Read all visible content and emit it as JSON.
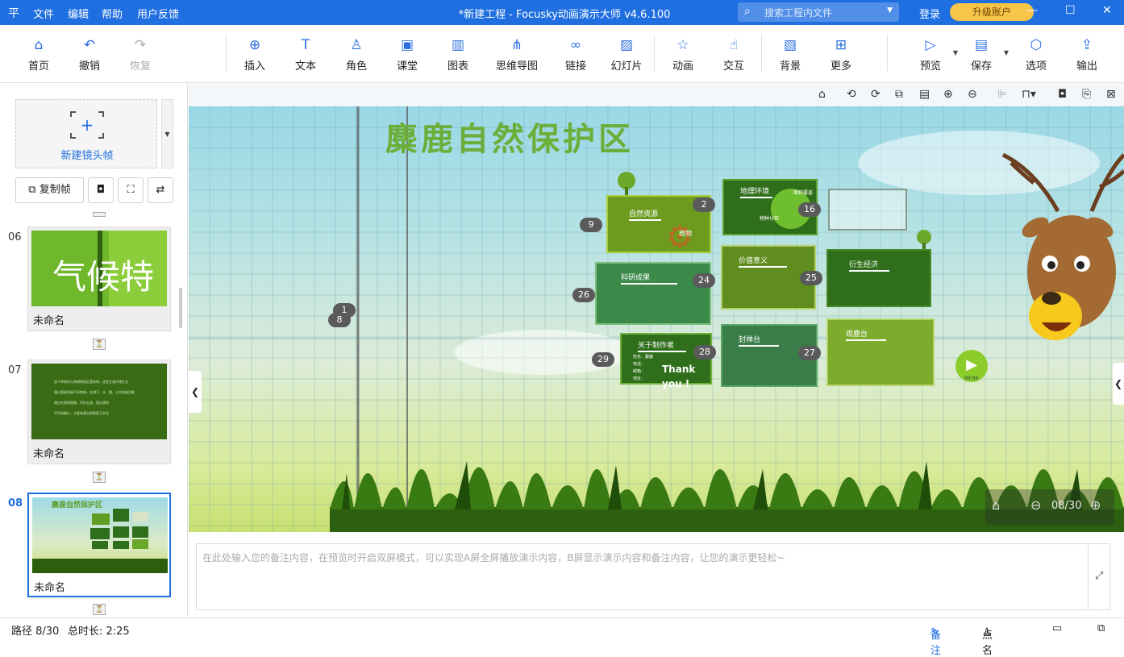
{
  "titlebar": {
    "logo": "平",
    "menu": [
      "文件",
      "编辑",
      "帮助",
      "用户反馈"
    ],
    "title": "*新建工程 - Focusky动画演示大师  v4.6.100",
    "search_placeholder": "搜索工程内文件",
    "login": "登录",
    "upgrade": "升级账户",
    "window_buttons": [
      "—",
      "☐",
      "✕"
    ]
  },
  "toolbar": {
    "home": "首页",
    "undo": "撤销",
    "redo": "恢复",
    "insert": "插入",
    "text": "文本",
    "role": "角色",
    "classroom": "课堂",
    "chart": "图表",
    "mindmap": "思维导图",
    "link": "链接",
    "slide": "幻灯片",
    "animation": "动画",
    "interact": "交互",
    "background": "背景",
    "more": "更多",
    "preview": "预览",
    "save": "保存",
    "options": "选项",
    "export": "输出"
  },
  "sidebar": {
    "new_frame": "新建镜头帧",
    "copy_frame": "复制帧",
    "slides": [
      {
        "number": "06",
        "name": "未命名",
        "thumb_text": "气候特"
      },
      {
        "number": "07",
        "name": "未命名",
        "thumb_lines": [
          "该干旱地机与海湖和地区宽地带，适宜生态环境生长",
          "通过限制发展干旱地带，在湖下、水、路、公共设施功能",
          "通过在营养植物，评估五成，而后规划",
          "早开始确认，主要来源自然景星习文化"
        ]
      },
      {
        "number": "08",
        "name": "未命名",
        "thumb_title": "麋鹿自然保护区"
      }
    ]
  },
  "stage": {
    "title": "麋鹿自然保护区",
    "boxes": {
      "natural": {
        "title": "自然资源",
        "sub": "植物"
      },
      "geo": {
        "title": "地理环境",
        "sub1": "面积覆盖",
        "sub2": "物种分布"
      },
      "science": {
        "title": "科研成果"
      },
      "value": {
        "title": "价值意义"
      },
      "derived": {
        "title": "衍生经济"
      },
      "author": {
        "title": "关于制作者",
        "rows": [
          "姓名：麋鹿",
          "电话：",
          "邮箱：",
          "地址："
        ]
      },
      "altar": {
        "title": "封禅台"
      },
      "viewdeck": {
        "title": "观鹿台"
      },
      "thank": "Thank you !"
    },
    "badges": [
      "2",
      "9",
      "16",
      "24",
      "25",
      "26",
      "27",
      "28",
      "29",
      "1",
      "8"
    ],
    "play_time": "00:00",
    "nav_counter": "08/30"
  },
  "notes": {
    "placeholder": "在此处输入您的备注内容，在预览时开启双屏模式，可以实现A屏全屏播放演示内容，B屏显示演示内容和备注内容，让您的演示更轻松~"
  },
  "status": {
    "path": "路径 8/30",
    "duration": "总时长: 2:25",
    "notes": "备注",
    "rollcall": "点名"
  }
}
